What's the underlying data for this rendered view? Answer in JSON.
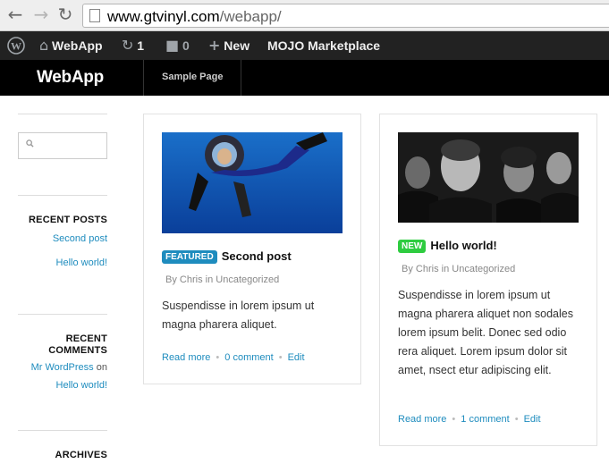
{
  "browser": {
    "url_domain": "www.gtvinyl.com",
    "url_path": "/webapp/"
  },
  "adminbar": {
    "site_name": "WebApp",
    "updates_count": "1",
    "comments_count": "0",
    "new_label": "New",
    "marketplace_label": "MOJO Marketplace"
  },
  "header": {
    "site_title": "WebApp",
    "menu": [
      "Sample Page"
    ]
  },
  "sidebar": {
    "recent_posts_title": "RECENT POSTS",
    "recent_posts": [
      "Second post",
      "Hello world!"
    ],
    "recent_comments_title": "RECENT COMMENTS",
    "recent_comments_title_lines": [
      "RECENT",
      "COMMENTS"
    ],
    "comment_author": "Mr WordPress",
    "comment_on": "on",
    "comment_post": "Hello world!",
    "archives_title": "ARCHIVES"
  },
  "posts": [
    {
      "badge": "FEATURED",
      "title": "Second post",
      "by": "By",
      "author": "Chris",
      "in": "in",
      "category": "Uncategorized",
      "excerpt": "Suspendisse in lorem ipsum ut magna pharera aliquet.",
      "read_more": "Read more",
      "comments": "0 comment",
      "edit": "Edit"
    },
    {
      "badge": "NEW",
      "title": "Hello world!",
      "by": "By",
      "author": "Chris",
      "in": "in",
      "category": "Uncategorized",
      "excerpt": "Suspendisse in lorem ipsum ut magna pharera aliquet non sodales lorem ipsum belit. Donec sed odio rera aliquet. Lorem ipsum dolor sit amet, nsect etur adipiscing elit.",
      "read_more": "Read more",
      "comments": "1 comment",
      "edit": "Edit"
    }
  ],
  "colors": {
    "link": "#1e8cbe",
    "featured_badge": "#1e8cbe",
    "new_badge": "#2ecc40"
  }
}
